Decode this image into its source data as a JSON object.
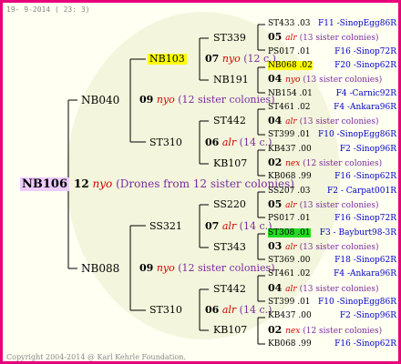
{
  "header": {
    "date": "19-  9-2014 ( 23:  3)"
  },
  "root": {
    "id": "NB106",
    "year": "12",
    "breeder": "nyo",
    "note": "(Drones from 12 sister colonies)"
  },
  "g1": [
    {
      "id": "NB040",
      "year": "09",
      "breeder": "nyo",
      "note": "(12 sister colonies)"
    },
    {
      "id": "NB088",
      "year": "09",
      "breeder": "nyo",
      "note": "(12 sister colonies)"
    }
  ],
  "g2": [
    {
      "id": "NB103",
      "year": "07",
      "breeder": "nyo",
      "note": "(12 c.)"
    },
    {
      "id": "ST310",
      "year": "06",
      "breeder": "alr",
      "note": "(14 c.)"
    },
    {
      "id": "SS321",
      "year": "07",
      "breeder": "alr",
      "note": "(14 c.)"
    },
    {
      "id": "ST310",
      "year": "06",
      "breeder": "alr",
      "note": "(14 c.)"
    }
  ],
  "g3": [
    {
      "id": "ST339"
    },
    {
      "id": "NB191"
    },
    {
      "id": "ST442"
    },
    {
      "id": "KB107"
    },
    {
      "id": "SS220"
    },
    {
      "id": "ST343"
    },
    {
      "id": "ST442"
    },
    {
      "id": "KB107"
    }
  ],
  "leaves": [
    {
      "type": "id",
      "id": "ST433",
      "suffix": ".03",
      "label": "F11 -SinopEgg86R"
    },
    {
      "type": "mid",
      "year": "05",
      "breeder": "alr",
      "note": "(13 sister colonies)"
    },
    {
      "type": "id",
      "id": "PS017",
      "suffix": ".01",
      "label": "F16 -Sinop72R"
    },
    {
      "type": "id",
      "id": "NB068",
      "suffix": ".02",
      "label": "F20 -Sinop62R",
      "highlight": "#ffff00"
    },
    {
      "type": "mid",
      "year": "04",
      "breeder": "nyo",
      "note": "(13 sister colonies)"
    },
    {
      "type": "id",
      "id": "NB154",
      "suffix": ".01",
      "label": "F4 -Carnic92R"
    },
    {
      "type": "id",
      "id": "ST461",
      "suffix": ".02",
      "label": "F4 -Ankara96R"
    },
    {
      "type": "mid",
      "year": "04",
      "breeder": "alr",
      "note": "(13 sister colonies)"
    },
    {
      "type": "id",
      "id": "ST399",
      "suffix": ".01",
      "label": "F10 -SinopEgg86R"
    },
    {
      "type": "id",
      "id": "KB437",
      "suffix": ".00",
      "label": "F2 -Sinop96R"
    },
    {
      "type": "mid",
      "year": "02",
      "breeder": "nex",
      "note": "(12 sister colonies)"
    },
    {
      "type": "id",
      "id": "KB068",
      "suffix": ".99",
      "label": "F16 -Sinop62R"
    },
    {
      "type": "id",
      "id": "SS207",
      "suffix": ".03",
      "label": "F2 - Carpat001R"
    },
    {
      "type": "mid",
      "year": "05",
      "breeder": "alr",
      "note": "(13 sister colonies)"
    },
    {
      "type": "id",
      "id": "PS017",
      "suffix": ".01",
      "label": "F16 -Sinop72R"
    },
    {
      "type": "id",
      "id": "ST308",
      "suffix": ".01",
      "label": "F3 - Bayburt98-3R",
      "highlight": "#22dd22"
    },
    {
      "type": "mid",
      "year": "03",
      "breeder": "alr",
      "note": "(13 sister colonies)"
    },
    {
      "type": "id",
      "id": "ST369",
      "suffix": ".00",
      "label": "F18 -Sinop62R"
    },
    {
      "type": "id",
      "id": "ST461",
      "suffix": ".02",
      "label": "F4 -Ankara96R"
    },
    {
      "type": "mid",
      "year": "04",
      "breeder": "alr",
      "note": "(13 sister colonies)"
    },
    {
      "type": "id",
      "id": "ST399",
      "suffix": ".01",
      "label": "F10 -SinopEgg86R"
    },
    {
      "type": "id",
      "id": "KB437",
      "suffix": ".00",
      "label": "F2 -Sinop96R"
    },
    {
      "type": "mid",
      "year": "02",
      "breeder": "nex",
      "note": "(12 sister colonies)"
    },
    {
      "type": "id",
      "id": "KB068",
      "suffix": ".99",
      "label": "F16 -Sinop62R"
    }
  ],
  "footer": {
    "copyright": "Copyright 2004-2014 @ Karl Kehrle Foundation."
  }
}
